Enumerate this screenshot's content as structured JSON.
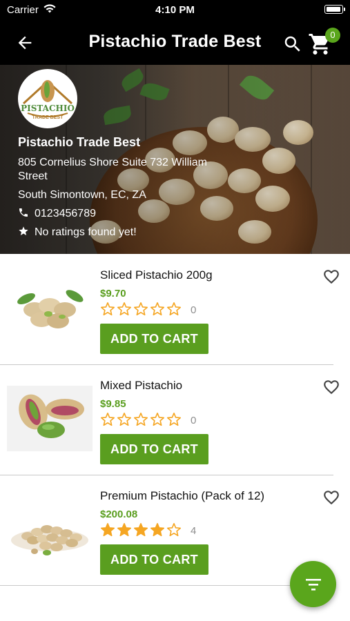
{
  "status_bar": {
    "carrier": "Carrier",
    "time": "4:10 PM"
  },
  "header": {
    "title": "Pistachio Trade Best",
    "cart_count": "0"
  },
  "store": {
    "logo_text": "PISTACHIO",
    "logo_subtext": "TRADE BEST",
    "name": "Pistachio Trade Best",
    "address_line1": "805 Cornelius Shore Suite 732 William Street",
    "address_line2": "South Simontown, EC, ZA",
    "phone": "0123456789",
    "rating_text": "No ratings found yet!"
  },
  "theme": {
    "accent": "#5a9e1f",
    "star": "#f5a623",
    "header_bg": "#000000"
  },
  "products": [
    {
      "name": "Sliced Pistachio 200g",
      "price": "$9.70",
      "rating": 0,
      "rating_count": "0",
      "add_label": "ADD TO CART"
    },
    {
      "name": "Mixed Pistachio",
      "price": "$9.85",
      "rating": 0,
      "rating_count": "0",
      "add_label": "ADD TO CART"
    },
    {
      "name": "Premium Pistachio (Pack of 12)",
      "price": "$200.08",
      "rating": 4,
      "rating_count": "4",
      "add_label": "ADD TO CART"
    }
  ],
  "icons": {
    "back": "arrow-left-icon",
    "search": "search-icon",
    "cart": "cart-icon",
    "phone": "phone-icon",
    "rating": "star-icon",
    "favorite": "heart-outline-icon",
    "filter": "filter-icon"
  }
}
